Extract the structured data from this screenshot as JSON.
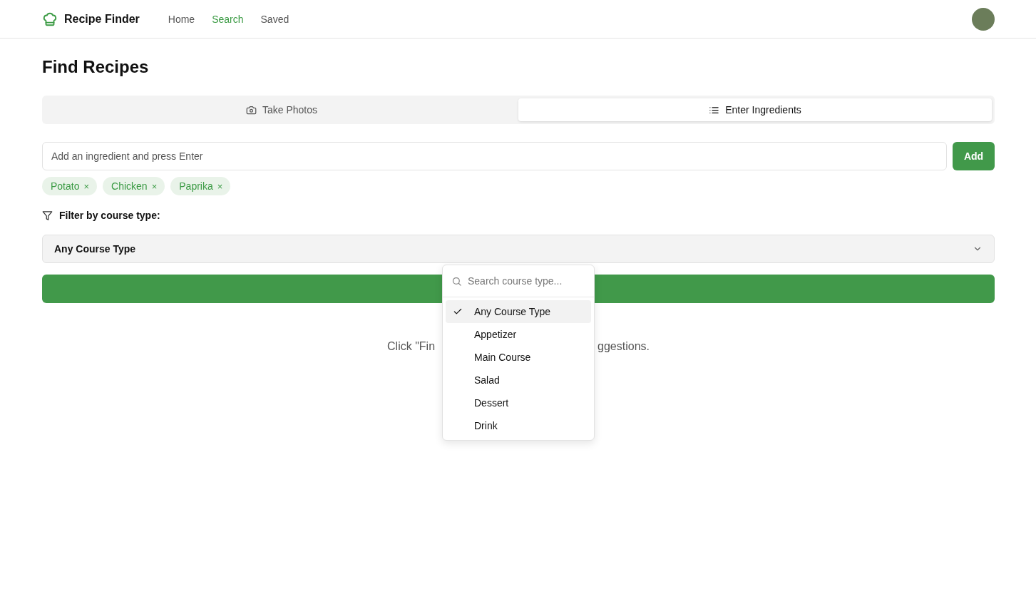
{
  "header": {
    "brand": "Recipe Finder",
    "nav": [
      {
        "label": "Home",
        "selected": false
      },
      {
        "label": "Search",
        "selected": true
      },
      {
        "label": "Saved",
        "selected": false
      }
    ]
  },
  "page_title": "Find Recipes",
  "mode_tabs": [
    {
      "label": "Take Photos",
      "selected": false
    },
    {
      "label": "Enter Ingredients",
      "selected": true
    }
  ],
  "ingredient_input": {
    "placeholder": "Add an ingredient and press Enter",
    "button": "Add"
  },
  "ingredients": [
    {
      "label": "Potato",
      "remove": "×"
    },
    {
      "label": "Chicken",
      "remove": "×"
    },
    {
      "label": "Paprika",
      "remove": "×"
    }
  ],
  "filter": {
    "label": "Filter by course type:",
    "value": "Any Course Type"
  },
  "dropdown": {
    "search_placeholder": "Search course type...",
    "options": [
      {
        "label": "Any Course Type",
        "selected": true
      },
      {
        "label": "Appetizer",
        "selected": false
      },
      {
        "label": "Main Course",
        "selected": false
      },
      {
        "label": "Salad",
        "selected": false
      },
      {
        "label": "Dessert",
        "selected": false
      },
      {
        "label": "Drink",
        "selected": false
      }
    ]
  },
  "message_fragments": [
    "Click \"Fin",
    "ggestions."
  ]
}
